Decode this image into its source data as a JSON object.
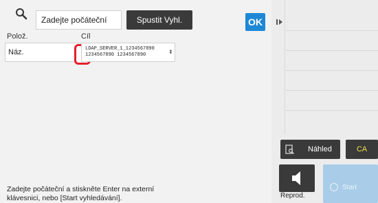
{
  "search": {
    "value": "Zadejte počáteční",
    "button_label": "Spustit Vyhl.",
    "ok_label": "OK"
  },
  "fields": {
    "item_label": "Polož.",
    "item_value": "Náz.",
    "target_label": "Cíl",
    "target_value": "LDAP_SERVER_1_1234567890\n1234567890 1234567890"
  },
  "help": {
    "text": "Zadejte počáteční a stiskněte Enter na externí klávesnici, nebo [Start vyhledávání]."
  },
  "side": {
    "preview_label": "Náhled",
    "ca_label": "CA",
    "reprod_label": "Reprod.",
    "start_label": "Start"
  },
  "colors": {
    "ok_blue": "#1e88d6",
    "highlight_red": "#e3202c",
    "ca_yellow": "#f0e04a",
    "start_disabled": "#a9cde8"
  }
}
